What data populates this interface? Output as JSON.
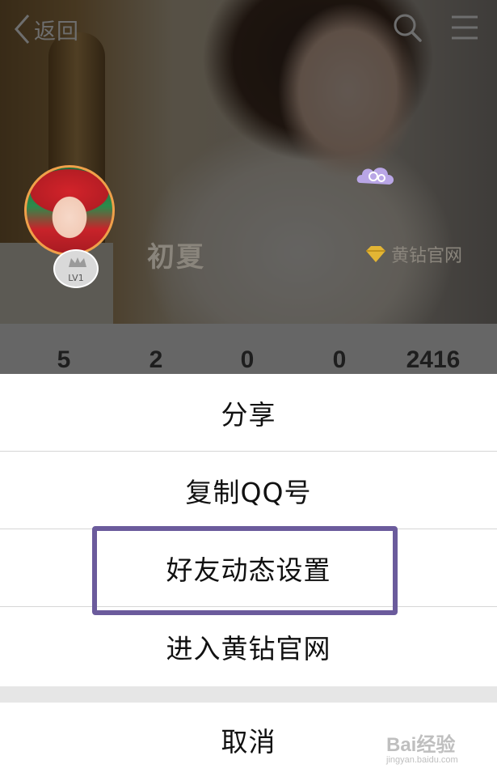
{
  "topbar": {
    "back_label": "返回",
    "icons": [
      "back-chevron-icon",
      "search-icon",
      "menu-icon"
    ]
  },
  "profile": {
    "nickname": "初夏",
    "level": "LV1",
    "vip_label": "黄钻官网",
    "vip_icon": "yellow-diamond-icon"
  },
  "stats": [
    "5",
    "2",
    "0",
    "0",
    "2416"
  ],
  "action_sheet": {
    "items": [
      "分享",
      "复制QQ号",
      "好友动态设置",
      "进入黄钻官网"
    ],
    "cancel": "取消",
    "highlighted_item": "好友动态设置",
    "highlight_color": "#6b5b9c"
  },
  "watermark": {
    "main": "Bai经验",
    "sub": "jingyan.baidu.com"
  }
}
